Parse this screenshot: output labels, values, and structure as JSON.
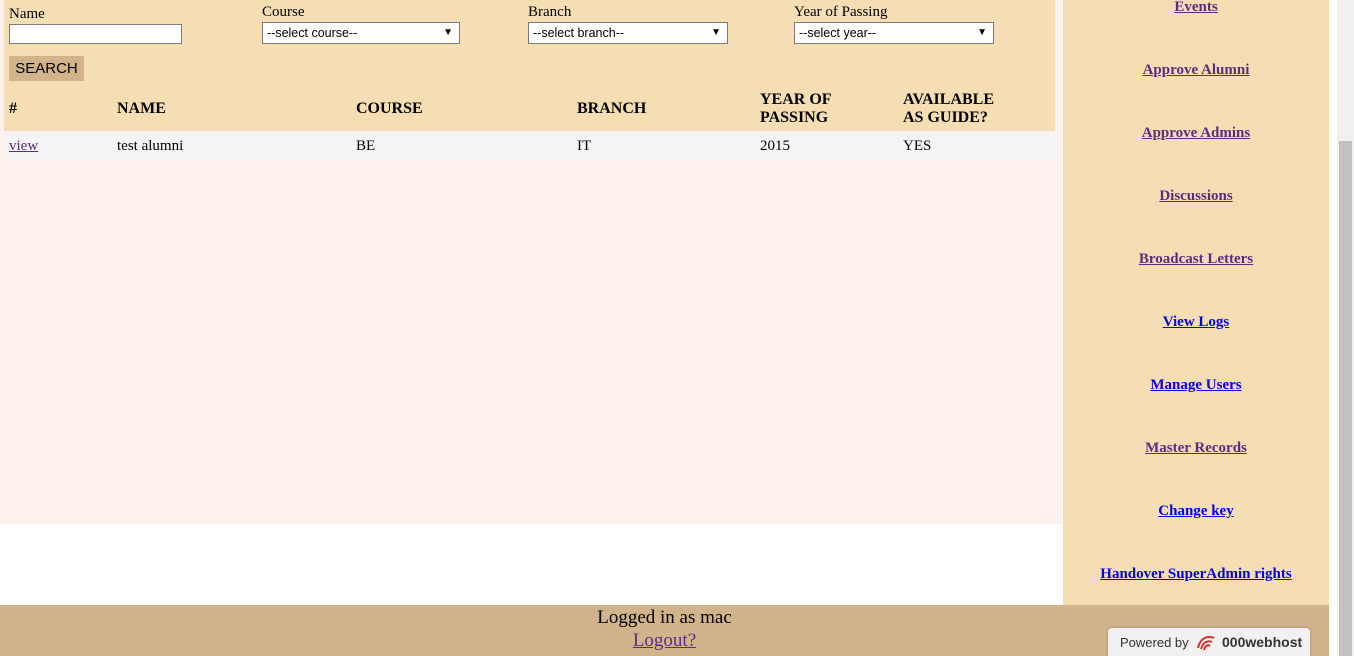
{
  "filters": {
    "name_label": "Name",
    "name_value": "",
    "course_label": "Course",
    "course_selected": "--select course--",
    "branch_label": "Branch",
    "branch_selected": "--select branch--",
    "year_label": "Year of Passing",
    "year_selected": "--select year--",
    "search_label": "SEARCH"
  },
  "table": {
    "headers": {
      "hash": "#",
      "name": "NAME",
      "course": "COURSE",
      "branch": "BRANCH",
      "year_line1": "YEAR OF",
      "year_line2": "PASSING",
      "guide_line1": "AVAILABLE",
      "guide_line2": "AS GUIDE?"
    },
    "rows": [
      {
        "action": "view",
        "name": "test alumni",
        "course": "BE",
        "branch": "IT",
        "year": "2015",
        "guide": "YES"
      }
    ]
  },
  "sidebar": {
    "items": [
      {
        "label": "Events"
      },
      {
        "label": "Approve Alumni"
      },
      {
        "label": "Approve Admins"
      },
      {
        "label": "Discussions"
      },
      {
        "label": "Broadcast Letters"
      },
      {
        "label": "View Logs"
      },
      {
        "label": "Manage Users"
      },
      {
        "label": "Master Records"
      },
      {
        "label": "Change key"
      },
      {
        "label": "Handover SuperAdmin rights"
      }
    ]
  },
  "footer": {
    "status": "Logged in as mac",
    "logout": "Logout?"
  },
  "badge": {
    "powered_by": "Powered by",
    "host": "000webhost"
  },
  "colors": {
    "panel": "#f5deb3",
    "footer": "#d2b48c",
    "visited_link": "#5a2d82",
    "unvisited_link": "#0000ee"
  }
}
